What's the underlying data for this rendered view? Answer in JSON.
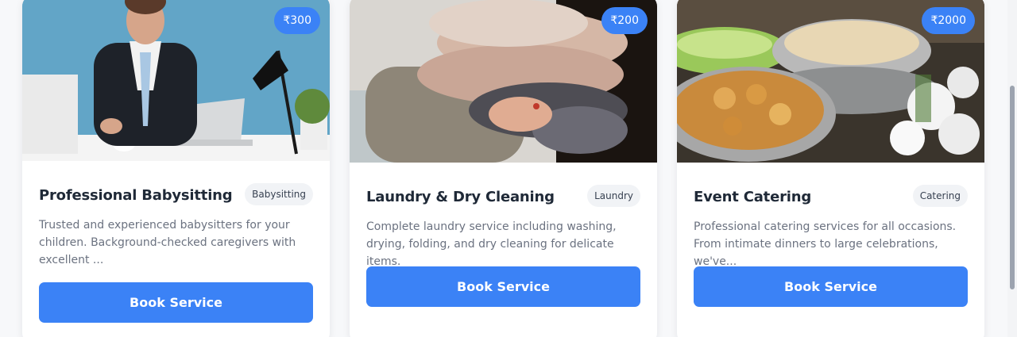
{
  "services": [
    {
      "title": "Professional Babysitting",
      "category": "Babysitting",
      "price": "₹300",
      "description": "Trusted and experienced babysitters for your children. Background-checked caregivers with excellent ...",
      "button_label": "Book Service",
      "image_subject": "businessman at desk"
    },
    {
      "title": "Laundry & Dry Cleaning",
      "category": "Laundry",
      "price": "₹200",
      "description": "Complete laundry service including washing, drying, folding, and dry cleaning for delicate items.",
      "button_label": "Book Service",
      "image_subject": "stack of folded sweaters"
    },
    {
      "title": "Event Catering",
      "category": "Catering",
      "price": "₹2000",
      "description": "Professional catering services for all occasions. From intimate dinners to large celebrations, we've...",
      "button_label": "Book Service",
      "image_subject": "catering buffet trays"
    }
  ],
  "colors": {
    "accent": "#3b82f6",
    "title": "#1f2937",
    "text_muted": "#6b7280",
    "badge_bg": "#f1f3f6"
  }
}
